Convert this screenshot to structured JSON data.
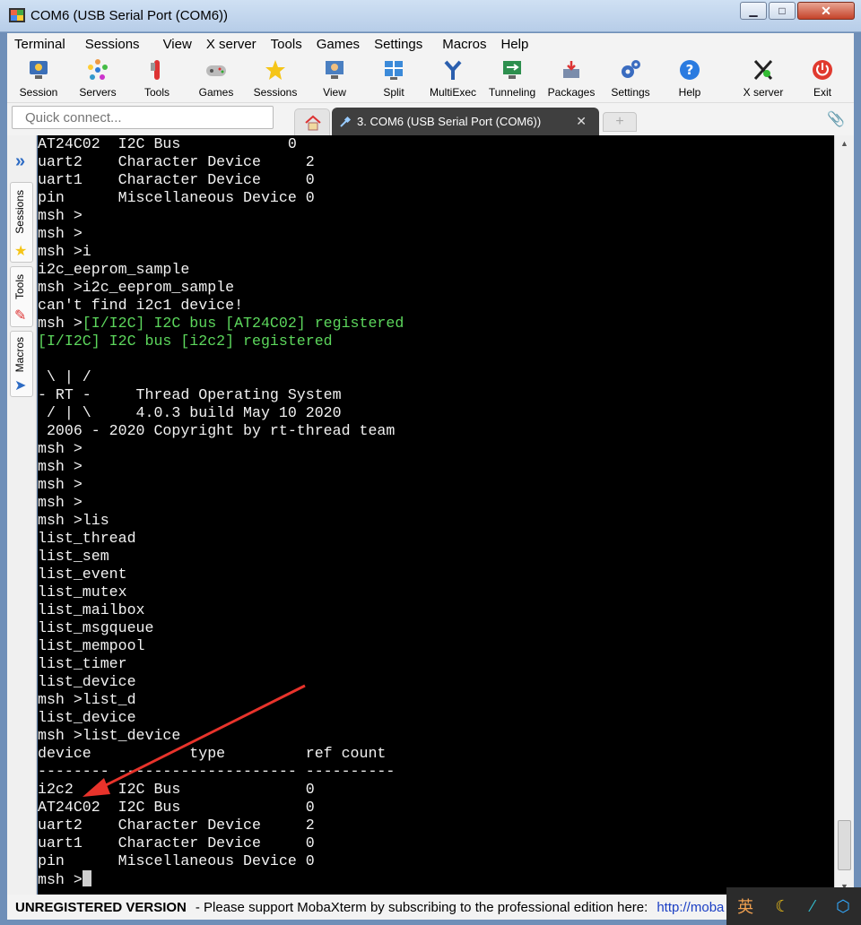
{
  "window": {
    "title": "COM6  (USB Serial Port (COM6))",
    "controls": {
      "minimize": "▁",
      "maximize": "□",
      "close": "✕"
    }
  },
  "menu": [
    "Terminal",
    "Sessions",
    "View",
    "X server",
    "Tools",
    "Games",
    "Settings",
    "Macros",
    "Help"
  ],
  "toolbar": [
    {
      "label": "Session",
      "icon": "session-icon"
    },
    {
      "label": "Servers",
      "icon": "servers-icon"
    },
    {
      "label": "Tools",
      "icon": "tools-icon"
    },
    {
      "label": "Games",
      "icon": "games-icon"
    },
    {
      "label": "Sessions",
      "icon": "sessions-star-icon"
    },
    {
      "label": "View",
      "icon": "view-icon"
    },
    {
      "label": "Split",
      "icon": "split-icon"
    },
    {
      "label": "MultiExec",
      "icon": "multiexec-icon"
    },
    {
      "label": "Tunneling",
      "icon": "tunneling-icon"
    },
    {
      "label": "Packages",
      "icon": "packages-icon"
    },
    {
      "label": "Settings",
      "icon": "settings-gears-icon"
    },
    {
      "label": "Help",
      "icon": "help-icon"
    },
    {
      "label": "X server",
      "icon": "xserver-icon"
    },
    {
      "label": "Exit",
      "icon": "exit-icon"
    }
  ],
  "quick_connect": {
    "placeholder": "Quick connect..."
  },
  "tabs": {
    "active_title": "3. COM6  (USB Serial Port (COM6))",
    "close": "✕",
    "new": "+"
  },
  "sidebar": {
    "tabs": [
      "Sessions",
      "Tools",
      "Macros"
    ]
  },
  "terminal": {
    "lines": [
      {
        "t": "AT24C02  I2C Bus            0"
      },
      {
        "t": "uart2    Character Device     2"
      },
      {
        "t": "uart1    Character Device     0"
      },
      {
        "t": "pin      Miscellaneous Device 0"
      },
      {
        "t": "msh >"
      },
      {
        "t": "msh >"
      },
      {
        "t": "msh >i"
      },
      {
        "t": "i2c_eeprom_sample"
      },
      {
        "t": "msh >i2c_eeprom_sample"
      },
      {
        "t": "can't find i2c1 device!"
      },
      {
        "t": "msh >",
        "g": "[I/I2C] I2C bus [AT24C02] registered"
      },
      {
        "g": "[I/I2C] I2C bus [i2c2] registered"
      },
      {
        "t": ""
      },
      {
        "t": " \\ | /"
      },
      {
        "t": "- RT -     Thread Operating System"
      },
      {
        "t": " / | \\     4.0.3 build May 10 2020"
      },
      {
        "t": " 2006 - 2020 Copyright by rt-thread team"
      },
      {
        "t": "msh >"
      },
      {
        "t": "msh >"
      },
      {
        "t": "msh >"
      },
      {
        "t": "msh >"
      },
      {
        "t": "msh >lis"
      },
      {
        "t": "list_thread"
      },
      {
        "t": "list_sem"
      },
      {
        "t": "list_event"
      },
      {
        "t": "list_mutex"
      },
      {
        "t": "list_mailbox"
      },
      {
        "t": "list_msgqueue"
      },
      {
        "t": "list_mempool"
      },
      {
        "t": "list_timer"
      },
      {
        "t": "list_device"
      },
      {
        "t": "msh >list_d"
      },
      {
        "t": "list_device"
      },
      {
        "t": "msh >list_device"
      },
      {
        "t": "device           type         ref count"
      },
      {
        "t": "-------- -------------------- ----------"
      },
      {
        "t": "i2c2     I2C Bus              0"
      },
      {
        "t": "AT24C02  I2C Bus              0"
      },
      {
        "t": "uart2    Character Device     2"
      },
      {
        "t": "uart1    Character Device     0"
      },
      {
        "t": "pin      Miscellaneous Device 0"
      },
      {
        "t": "msh >",
        "cursor": true
      }
    ]
  },
  "status": {
    "unregistered": "UNREGISTERED VERSION",
    "message": "-  Please support MobaXterm by subscribing to the professional edition here:",
    "link": "http://moba"
  },
  "ime": [
    "英",
    "☾",
    "⁄",
    "⬡"
  ],
  "colors": {
    "terminal_bg": "#000000",
    "terminal_fg": "#f2f2f2",
    "log_green": "#5cd65c",
    "arrow_red": "#e8332b"
  }
}
